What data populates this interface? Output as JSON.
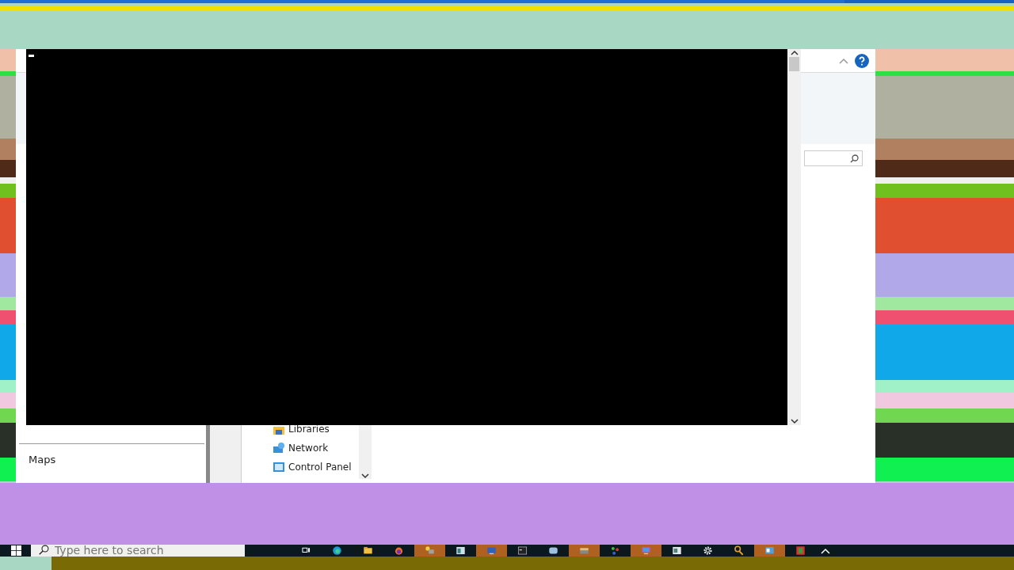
{
  "explorer": {
    "left_pane_item": "Maps",
    "nav_items": [
      {
        "label": "Libraries",
        "kind": "library"
      },
      {
        "label": "Network",
        "kind": "network"
      },
      {
        "label": "Control Panel",
        "kind": "control"
      }
    ]
  },
  "console": {
    "cursor": true
  },
  "taskbar": {
    "search": {
      "placeholder": "Type here to search"
    }
  }
}
